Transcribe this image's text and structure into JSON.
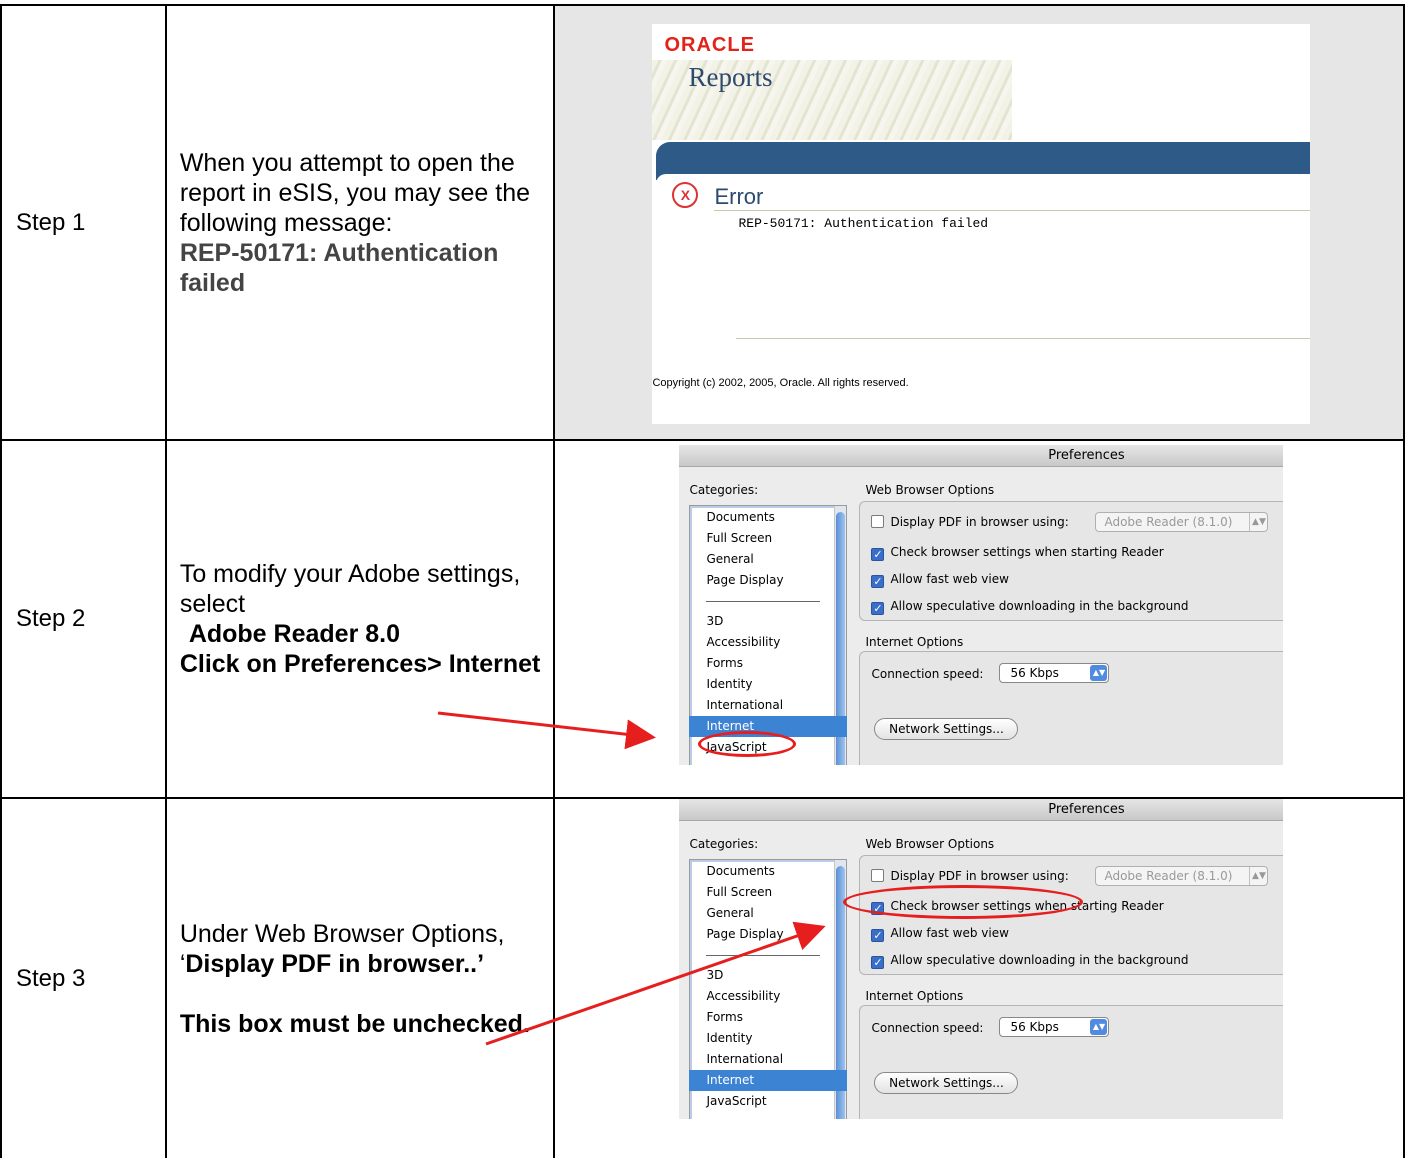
{
  "rows": [
    {
      "step": "Step 1",
      "desc_plain": "When you attempt to open the report in eSIS, you may see the following message:",
      "desc_bold": "REP-50171: Authentication failed"
    },
    {
      "step": "Step 2",
      "desc_plain": "To modify your Adobe settings, select",
      "desc_bold1": "Adobe Reader 8.0",
      "desc_bold2": "Click on Preferences> Internet"
    },
    {
      "step": "Step 3",
      "desc_plain": "Under Web Browser Options, ‘",
      "desc_bold1": "Display PDF in browser..’",
      "desc_bold2": "This box must be unchecked."
    }
  ],
  "oracle": {
    "logo": "ORACLE",
    "reports": "Reports",
    "error_title": "Error",
    "error_icon": "error-x-icon",
    "message": "REP-50171: Authentication failed",
    "copyright": "Copyright (c) 2002, 2005, Oracle. All rights reserved."
  },
  "prefs": {
    "title": "Preferences",
    "categories_label": "Categories:",
    "categories": [
      "Documents",
      "Full Screen",
      "General",
      "Page Display",
      "3D",
      "Accessibility",
      "Forms",
      "Identity",
      "International",
      "Internet",
      "JavaScript"
    ],
    "selected_category": "Internet",
    "web_group": "Web Browser Options",
    "display_pdf": "Display PDF in browser using:",
    "display_pdf_checked": false,
    "reader_select": "Adobe Reader (8.1.0)",
    "check_settings": "Check browser settings when starting Reader",
    "fast_web": "Allow fast web view",
    "speculative": "Allow speculative downloading in the background",
    "internet_group": "Internet Options",
    "speed_label": "Connection speed:",
    "speed_value": "56 Kbps",
    "network_button": "Network Settings...",
    "annotation_color": "#e61e1e"
  }
}
